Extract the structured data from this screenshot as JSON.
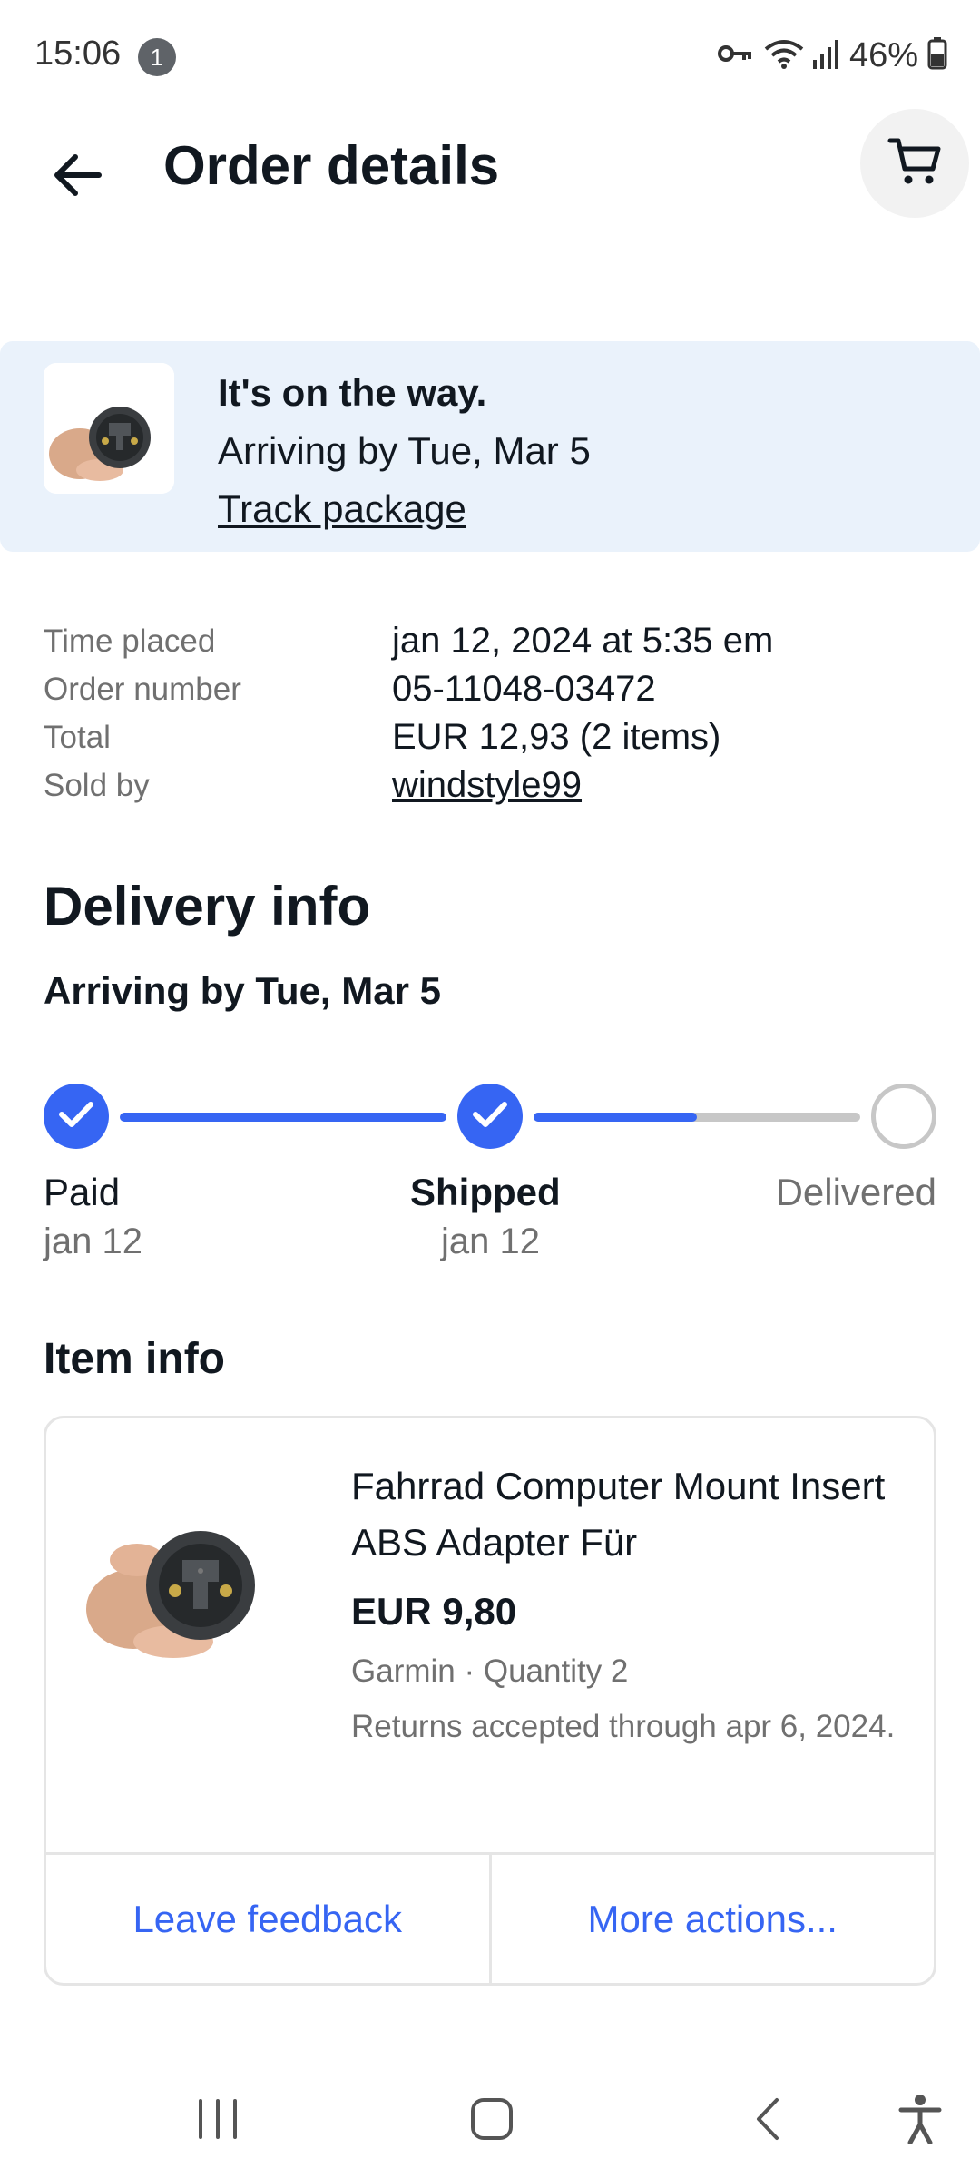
{
  "status_bar": {
    "time": "15:06",
    "notification_count": "1",
    "battery": "46%",
    "icons": [
      "key-icon",
      "wifi-icon",
      "signal-icon",
      "battery-icon"
    ]
  },
  "header": {
    "title": "Order details",
    "back_icon": "arrow-left-icon",
    "cart_icon": "cart-icon"
  },
  "banner": {
    "status": "It's on the way.",
    "arrival": "Arriving by Tue, Mar 5",
    "track_link": "Track package"
  },
  "summary": [
    {
      "label": "Time placed",
      "value": "jan 12, 2024 at 5:35 em"
    },
    {
      "label": "Order number",
      "value": "05-11048-03472"
    },
    {
      "label": "Total",
      "value": "EUR 12,93 (2 items)"
    },
    {
      "label": "Sold by",
      "value": "windstyle99"
    }
  ],
  "delivery": {
    "title": "Delivery info",
    "subtitle": "Arriving by Tue, Mar 5",
    "steps": [
      {
        "label": "Paid",
        "date": "jan 12",
        "done": true
      },
      {
        "label": "Shipped",
        "date": "jan 12",
        "done": true
      },
      {
        "label": "Delivered",
        "date": "",
        "done": false
      }
    ],
    "shipped_to_delivered_progress": 0.5
  },
  "item": {
    "section_title": "Item info",
    "name": "Fahrrad Computer Mount Insert ABS Adapter Für",
    "price": "EUR 9,80",
    "meta": "Garmin · Quantity 2",
    "returns": " Returns accepted through apr 6, 2024.",
    "actions": [
      "Leave feedback",
      "More actions..."
    ]
  },
  "navbar": {
    "icons": [
      "recent-apps-icon",
      "home-icon",
      "back-icon",
      "accessibility-icon"
    ]
  },
  "colors": {
    "accent": "#3665f3",
    "banner_bg": "#eaf2fb",
    "text": "#111820",
    "muted": "#707070"
  }
}
